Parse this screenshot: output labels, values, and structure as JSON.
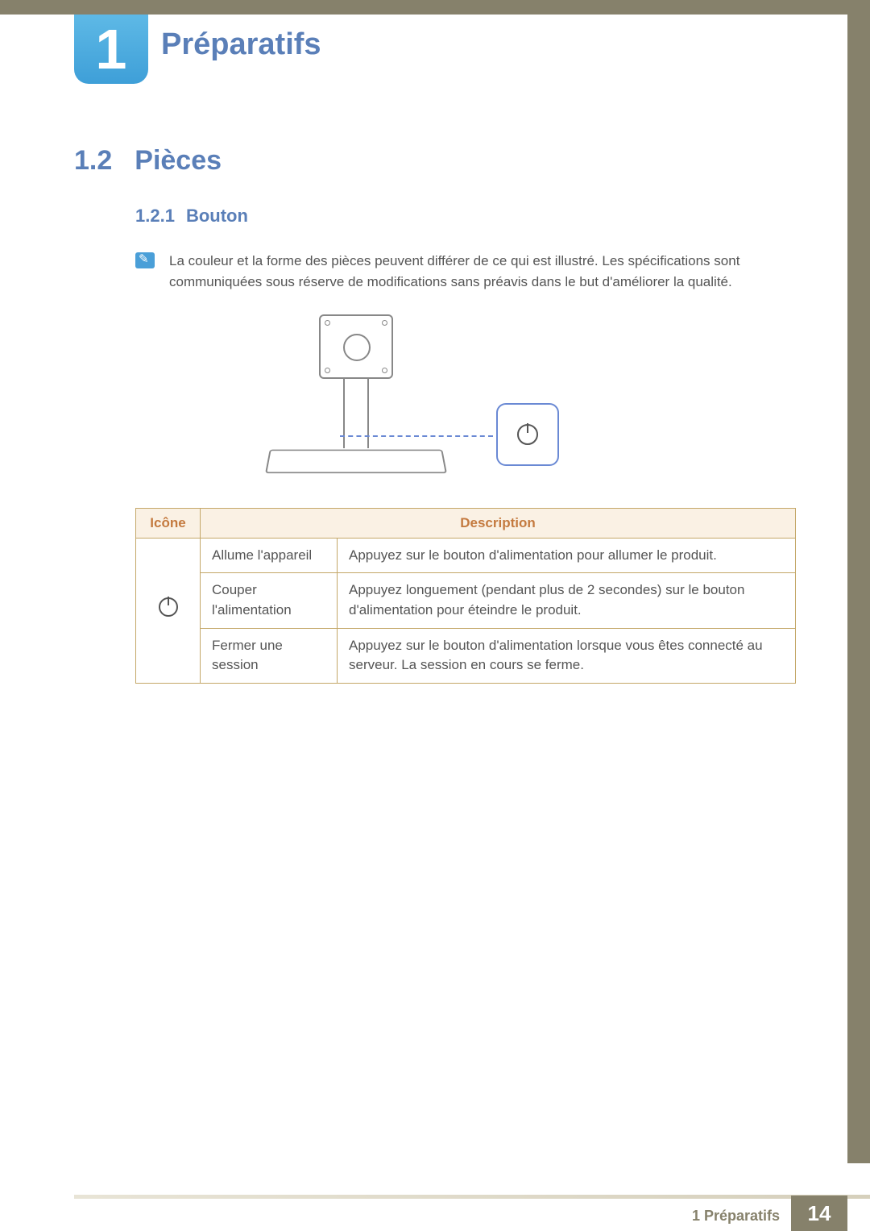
{
  "chapter": {
    "number": "1",
    "title": "Préparatifs"
  },
  "section": {
    "number": "1.2",
    "title": "Pièces"
  },
  "subsection": {
    "number": "1.2.1",
    "title": "Bouton"
  },
  "note": "La couleur et la forme des pièces peuvent différer de ce qui est illustré. Les spécifications sont communiquées sous réserve de modifications sans préavis dans le but d'améliorer la qualité.",
  "table": {
    "headers": {
      "icon": "Icône",
      "description": "Description"
    },
    "rows": [
      {
        "action": "Allume l'appareil",
        "description": "Appuyez sur le bouton d'alimentation pour allumer le produit."
      },
      {
        "action": "Couper l'alimentation",
        "description": "Appuyez longuement (pendant plus de 2 secondes) sur le bouton d'alimentation pour éteindre le produit."
      },
      {
        "action": "Fermer une session",
        "description": "Appuyez sur le bouton d'alimentation lorsque vous êtes connecté au serveur. La session en cours se ferme."
      }
    ]
  },
  "footer": {
    "breadcrumb": "1 Préparatifs",
    "page": "14"
  }
}
